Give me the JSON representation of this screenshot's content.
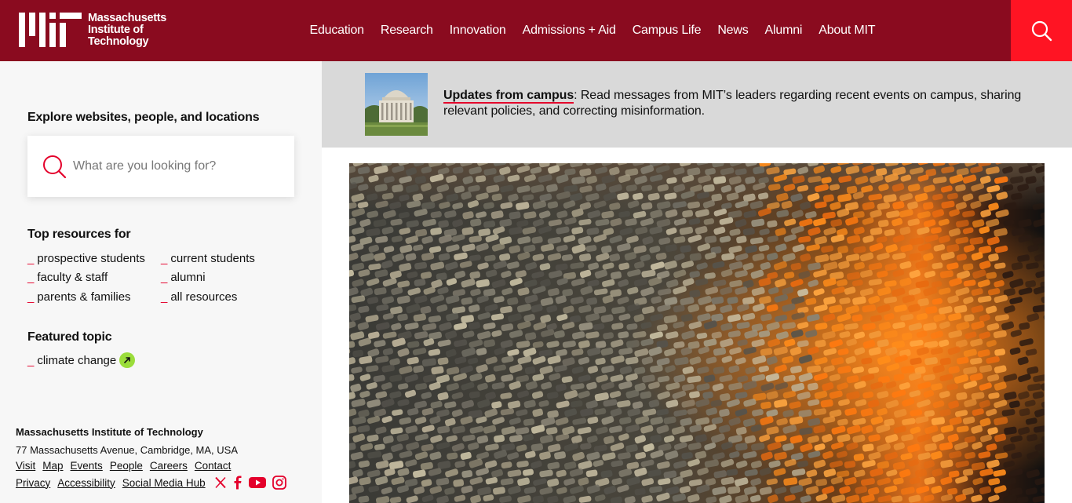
{
  "header": {
    "logo_lines": [
      "Massachusetts",
      "Institute of",
      "Technology"
    ],
    "nav": [
      "Education",
      "Research",
      "Innovation",
      "Admissions + Aid",
      "Campus Life",
      "News",
      "Alumni",
      "About MIT"
    ],
    "search_icon": "search-icon",
    "colors": {
      "header_bg": "#8a0b1f",
      "search_bg": "#ff1423"
    }
  },
  "sidebar": {
    "explore_title": "Explore websites, people, and locations",
    "search_placeholder": "What are you looking for?",
    "top_resources_title": "Top resources for",
    "resources": [
      "prospective students",
      "current students",
      "faculty & staff",
      "alumni",
      "parents & families",
      "all resources"
    ],
    "featured_title": "Featured topic",
    "featured_topic": "climate change",
    "dash": "_"
  },
  "footer": {
    "org": "Massachusetts Institute of Technology",
    "address": "77 Massachusetts Avenue, Cambridge, MA, USA",
    "links_row1": [
      "Visit",
      "Map",
      "Events",
      "People",
      "Careers",
      "Contact"
    ],
    "links_row2": [
      "Privacy",
      "Accessibility",
      "Social Media Hub"
    ],
    "social_icons": [
      "x-icon",
      "facebook-icon",
      "youtube-icon",
      "instagram-icon"
    ]
  },
  "banner": {
    "link_text": "Updates from campus",
    "body_text": ": Read messages from MIT’s leaders regarding recent events on campus, sharing relevant policies, and correcting misinformation."
  },
  "accent_color": "#e4002b"
}
